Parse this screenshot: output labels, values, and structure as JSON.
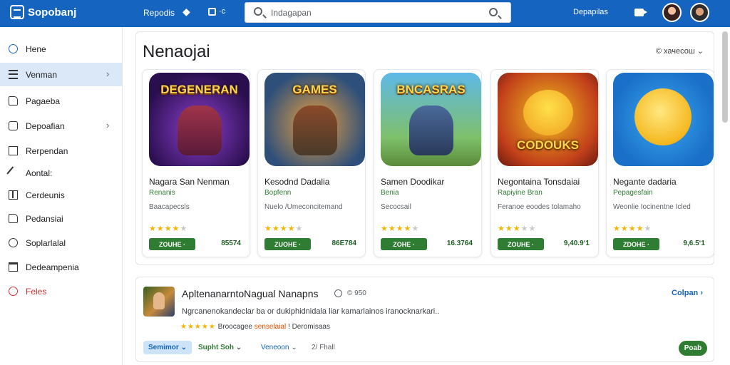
{
  "header": {
    "app_name": "Sopobanj",
    "nav_link": "Repodis",
    "tool_label": "·c",
    "search_placeholder": "Indagapan",
    "right_link": "Depapilas"
  },
  "sidebar": {
    "items": [
      {
        "label": "Hene",
        "icon": "home-icon"
      },
      {
        "label": "Venman",
        "icon": "list-icon",
        "active": true,
        "chevron": true
      },
      {
        "label": "Pagaeba",
        "icon": "document-icon"
      },
      {
        "label": "Depoafian",
        "icon": "bag-icon",
        "chevron": true
      },
      {
        "label": "Rerpendan",
        "icon": "box-icon"
      },
      {
        "label": "Aontal:",
        "icon": "pen-icon"
      },
      {
        "label": "Cerdeunis",
        "icon": "grid-icon"
      },
      {
        "label": "Pedansiai",
        "icon": "ring-icon"
      },
      {
        "label": "Soplarlalal",
        "icon": "settings-icon"
      },
      {
        "label": "Dedeampenia",
        "icon": "calendar-icon"
      },
      {
        "label": "Feles",
        "icon": "bug-icon",
        "danger": true
      }
    ]
  },
  "section": {
    "title": "Nenaojai",
    "sort_label": "© хачесош"
  },
  "cards": [
    {
      "art_text": "DEGENERAN",
      "title": "Nagara San Nenman",
      "developer": "Renanis",
      "category": "Baacapecsls",
      "stars": 4,
      "button": "ZOUHE ·",
      "price": "85574"
    },
    {
      "art_text": "GAMES",
      "title": "Kesodnd Dadalia",
      "developer": "Bopfenn",
      "category": "Nuelo /Umeconcitemand",
      "stars": 4,
      "button": "ZUOHE ·",
      "price": "86E784"
    },
    {
      "art_text": "BNCASRAS",
      "title": "Samen Doodikar",
      "developer": "Benia",
      "category": "Secocsail",
      "stars": 4,
      "button": "ZOHE ·",
      "price": "16.3764"
    },
    {
      "art_text": "CODOUKS",
      "title": "Negontaina Tonsdaiai",
      "developer": "Rapiyine Bran",
      "category": "Feranoe eoodes tolamaho",
      "stars": 3,
      "button": "ZOUHE ·",
      "price": "9,40.9‘1"
    },
    {
      "art_text": "",
      "title": "Negante dadaria",
      "developer": "Pepagesfain",
      "category": "Weonlie Iocinentne Icled",
      "stars": 4,
      "button": "ZDOHE ·",
      "price": "9,6.5‘1"
    }
  ],
  "featured": {
    "title": "ApltenanarntoNagual Nanapns",
    "badge": "© 950",
    "link": "Colpan",
    "description": "Ngrcanenokandeclar ba or dukiphidnidala liar kamarlainos iranocknarkari..",
    "rating_text": "Broocagee",
    "rating_highlight": "senselaial",
    "rating_suffix": "! Deromisaas",
    "chips": [
      "Semimor",
      "Supht Soh",
      "Veneoon"
    ],
    "count": "2/ Fhall",
    "button": "Poab"
  },
  "colors": {
    "topbar": "#1565c0",
    "accent_green": "#2e7d32",
    "star": "#f4b400",
    "danger": "#d32f2f",
    "active_bg": "#dbe8f8"
  }
}
